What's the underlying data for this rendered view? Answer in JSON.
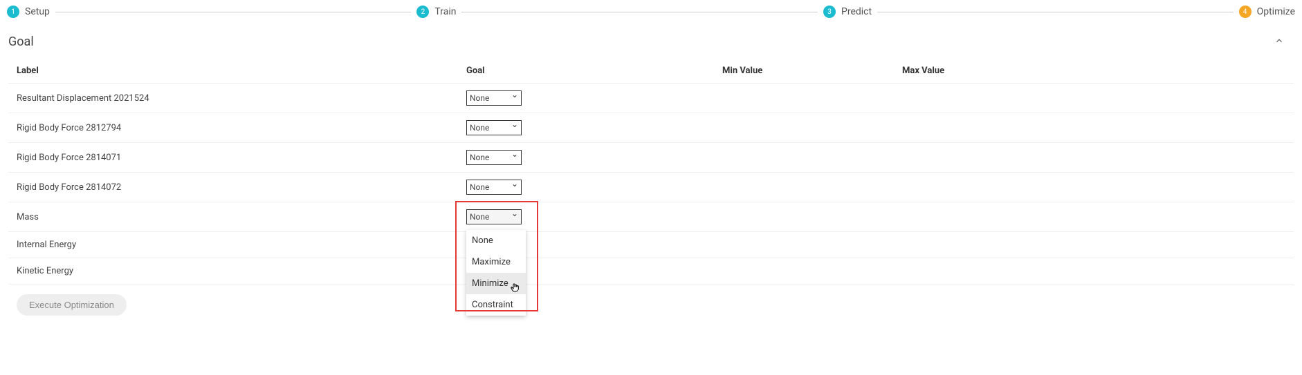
{
  "stepper": {
    "steps": [
      {
        "num": "1",
        "label": "Setup",
        "color": "teal"
      },
      {
        "num": "2",
        "label": "Train",
        "color": "teal"
      },
      {
        "num": "3",
        "label": "Predict",
        "color": "teal"
      },
      {
        "num": "4",
        "label": "Optimize",
        "color": "orange"
      }
    ]
  },
  "section": {
    "title": "Goal"
  },
  "columns": {
    "label": "Label",
    "goal": "Goal",
    "min": "Min Value",
    "max": "Max Value"
  },
  "rows": [
    {
      "label": "Resultant Displacement 2021524",
      "goal": "None"
    },
    {
      "label": "Rigid Body Force 2812794",
      "goal": "None"
    },
    {
      "label": "Rigid Body Force 2814071",
      "goal": "None"
    },
    {
      "label": "Rigid Body Force 2814072",
      "goal": "None"
    },
    {
      "label": "Mass",
      "goal": "None",
      "open": true
    },
    {
      "label": "Internal Energy",
      "goal": ""
    },
    {
      "label": "Kinetic Energy",
      "goal": ""
    }
  ],
  "dropdown": {
    "options": [
      "None",
      "Maximize",
      "Minimize",
      "Constraint"
    ],
    "hovered": "Minimize"
  },
  "execute_label": "Execute Optimization"
}
